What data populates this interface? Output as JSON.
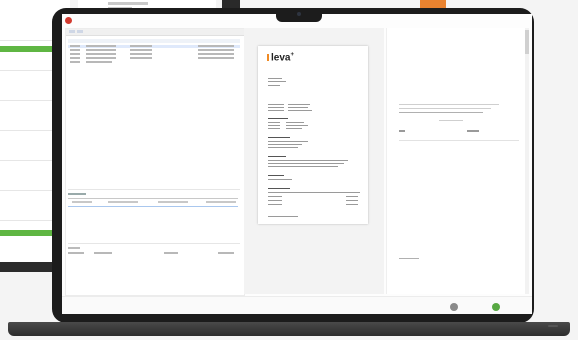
{
  "background": {
    "accent_green": "#5fb643",
    "accent_orange": "#e9822f"
  },
  "laptop": {
    "base_left_label": "",
    "base_right_label": ""
  },
  "app": {
    "icons": {
      "logo": "app-logo-icon"
    },
    "document": {
      "brand_name": "leva",
      "brand_suffix": "+",
      "brand_color": "#f08a24"
    },
    "footer": {
      "back_label": "",
      "approve_label": ""
    }
  }
}
